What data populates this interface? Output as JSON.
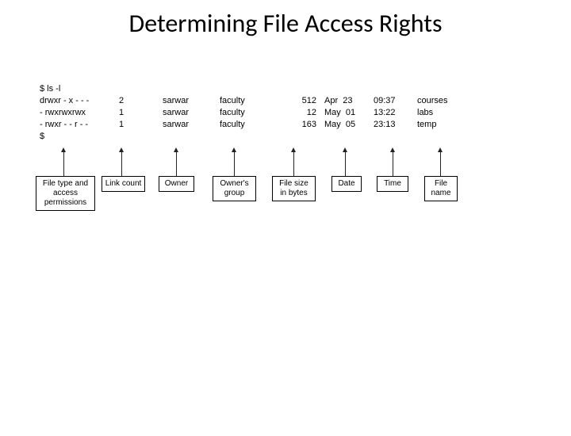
{
  "title": "Determining File Access Rights",
  "command": "$ ls -l",
  "prompt_end": "$",
  "rows": [
    {
      "perm": "drwxr - x - - -",
      "links": "2",
      "owner": "sarwar",
      "group": "faculty",
      "size": "512",
      "date": "Apr  23",
      "time": "09:37",
      "name": "courses"
    },
    {
      "perm": "- rwxrwxrwx",
      "links": "1",
      "owner": "sarwar",
      "group": "faculty",
      "size": "12",
      "date": "May  01",
      "time": "13:22",
      "name": "labs"
    },
    {
      "perm": "- rwxr - - r - -",
      "links": "1",
      "owner": "sarwar",
      "group": "faculty",
      "size": "163",
      "date": "May  05",
      "time": "23:13",
      "name": "temp"
    }
  ],
  "labels": {
    "perm": "File type and access permissions",
    "links": "Link count",
    "owner": "Owner",
    "group": "Owner's group",
    "size": "File size in bytes",
    "date": "Date",
    "time": "Time",
    "name": "File name"
  }
}
